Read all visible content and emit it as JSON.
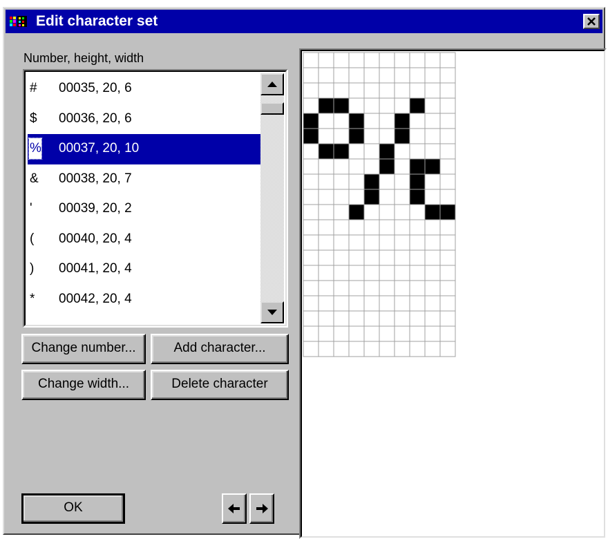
{
  "window": {
    "title": "Edit character set"
  },
  "list": {
    "label": "Number, height, width",
    "selected_index": 2,
    "items": [
      {
        "char": "#",
        "value": "00035, 20, 6"
      },
      {
        "char": "$",
        "value": "00036, 20, 6"
      },
      {
        "char": "%",
        "value": "00037, 20, 10"
      },
      {
        "char": "&",
        "value": "00038, 20, 7"
      },
      {
        "char": "'",
        "value": "00039, 20, 2"
      },
      {
        "char": "(",
        "value": "00040, 20, 4"
      },
      {
        "char": ")",
        "value": "00041, 20, 4"
      },
      {
        "char": "*",
        "value": "00042, 20, 4"
      }
    ]
  },
  "buttons": {
    "change_number": "Change number...",
    "add_character": "Add character...",
    "change_width": "Change width...",
    "delete_character": "Delete character",
    "ok": "OK"
  },
  "icons": {
    "close": "close-icon",
    "prev": "arrow-left-icon",
    "next": "arrow-right-icon",
    "scroll_up": "triangle-up-icon",
    "scroll_down": "triangle-down-icon"
  },
  "glyph_editor": {
    "cols": 10,
    "rows": 20,
    "pixels": [
      "..........",
      "..........",
      "..........",
      ".**....*..",
      "*..*..*...",
      "*..*..*...",
      ".**..*....",
      ".....*.**.",
      "....*..*..*",
      "....*..*..*",
      "...*....**.",
      "..........",
      "..........",
      "..........",
      "..........",
      "..........",
      "..........",
      "..........",
      "..........",
      ".........."
    ]
  }
}
